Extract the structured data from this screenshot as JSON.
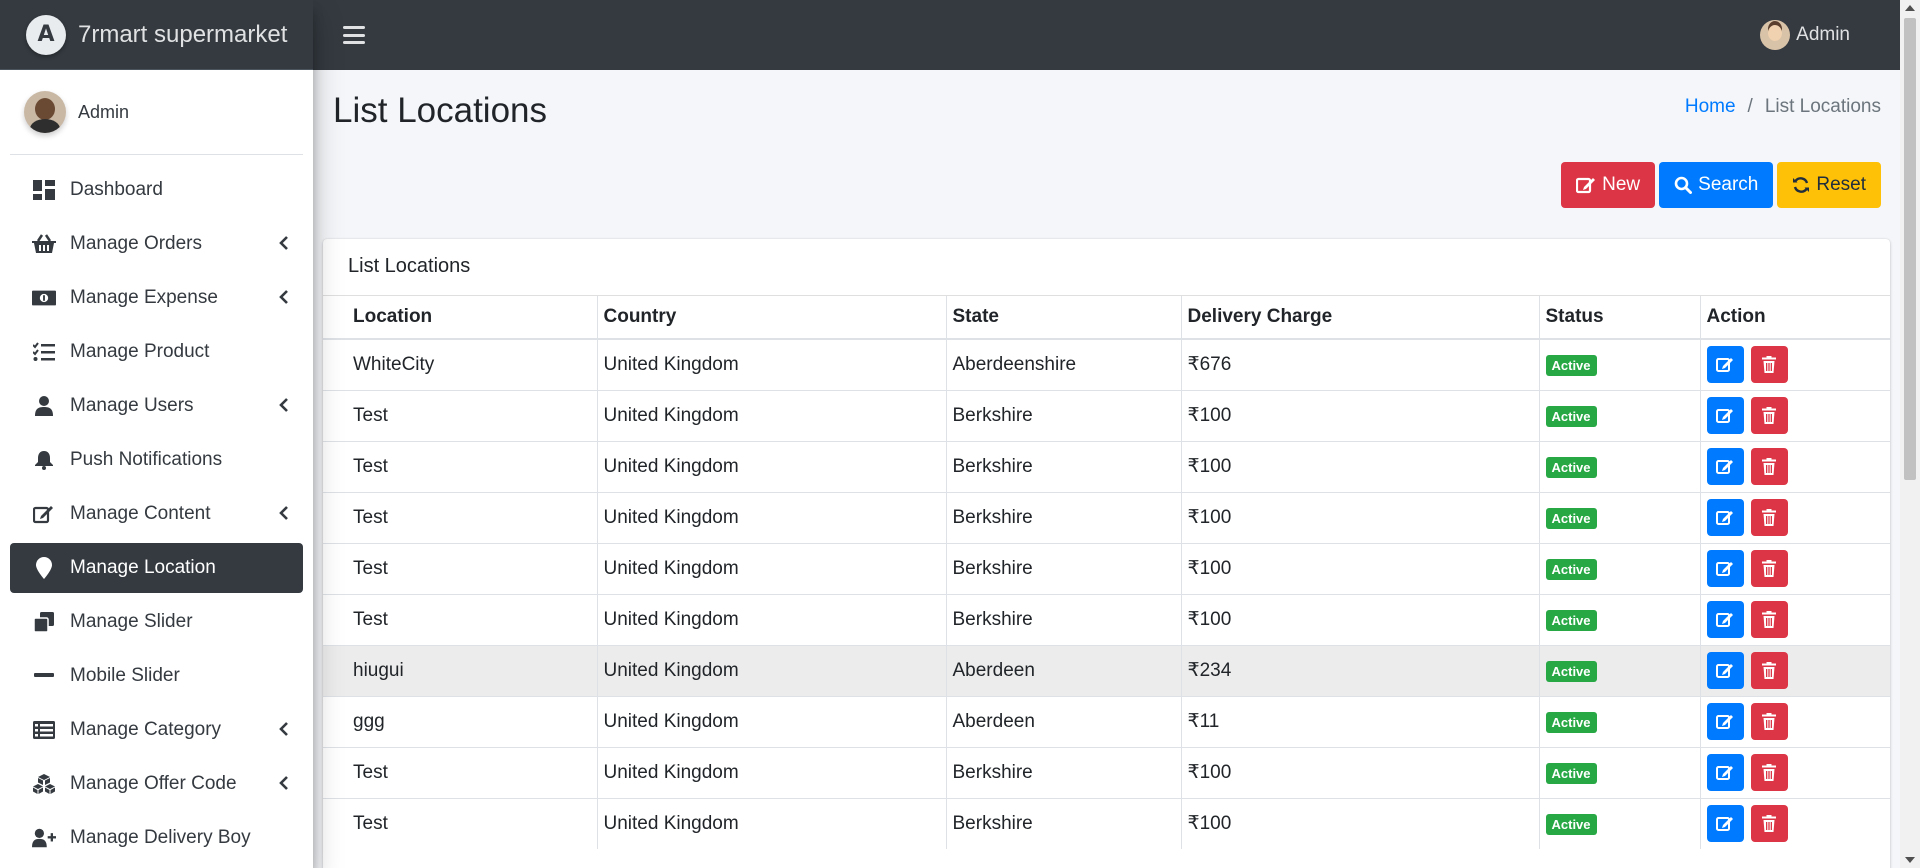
{
  "brand": {
    "logo_letter": "A",
    "name": "7rmart supermarket"
  },
  "sidebar_user": {
    "name": "Admin"
  },
  "nav": [
    {
      "label": "Dashboard",
      "icon": "dashboard-icon",
      "chevron": false,
      "active": false
    },
    {
      "label": "Manage Orders",
      "icon": "basket-icon",
      "chevron": true,
      "active": false
    },
    {
      "label": "Manage Expense",
      "icon": "money-icon",
      "chevron": true,
      "active": false
    },
    {
      "label": "Manage Product",
      "icon": "list-check-icon",
      "chevron": false,
      "active": false
    },
    {
      "label": "Manage Users",
      "icon": "user-icon",
      "chevron": true,
      "active": false
    },
    {
      "label": "Push Notifications",
      "icon": "bell-icon",
      "chevron": false,
      "active": false
    },
    {
      "label": "Manage Content",
      "icon": "edit-icon",
      "chevron": true,
      "active": false
    },
    {
      "label": "Manage Location",
      "icon": "map-marker-icon",
      "chevron": false,
      "active": true
    },
    {
      "label": "Manage Slider",
      "icon": "clone-icon",
      "chevron": false,
      "active": false
    },
    {
      "label": "Mobile Slider",
      "icon": "minus-icon",
      "chevron": false,
      "active": false
    },
    {
      "label": "Manage Category",
      "icon": "list-icon",
      "chevron": true,
      "active": false
    },
    {
      "label": "Manage Offer Code",
      "icon": "cubes-icon",
      "chevron": true,
      "active": false
    },
    {
      "label": "Manage Delivery Boy",
      "icon": "user-plus-icon",
      "chevron": false,
      "active": false
    }
  ],
  "topbar": {
    "user_name": "Admin"
  },
  "page": {
    "title": "List Locations",
    "breadcrumb": {
      "home": "Home",
      "separator": "/",
      "current": "List Locations"
    }
  },
  "buttons": {
    "new": "New",
    "search": "Search",
    "reset": "Reset"
  },
  "card": {
    "title": "List Locations"
  },
  "table": {
    "headers": [
      "Location",
      "Country",
      "State",
      "Delivery Charge",
      "Status",
      "Action"
    ],
    "rows": [
      [
        "WhiteCity",
        "United Kingdom",
        "Aberdeenshire",
        "₹676",
        "Active"
      ],
      [
        "Test",
        "United Kingdom",
        "Berkshire",
        "₹100",
        "Active"
      ],
      [
        "Test",
        "United Kingdom",
        "Berkshire",
        "₹100",
        "Active"
      ],
      [
        "Test",
        "United Kingdom",
        "Berkshire",
        "₹100",
        "Active"
      ],
      [
        "Test",
        "United Kingdom",
        "Berkshire",
        "₹100",
        "Active"
      ],
      [
        "Test",
        "United Kingdom",
        "Berkshire",
        "₹100",
        "Active"
      ],
      [
        "hiugui",
        "United Kingdom",
        "Aberdeen",
        "₹234",
        "Active"
      ],
      [
        "ggg",
        "United Kingdom",
        "Aberdeen",
        "₹11",
        "Active"
      ],
      [
        "Test",
        "United Kingdom",
        "Berkshire",
        "₹100",
        "Active"
      ],
      [
        "Test",
        "United Kingdom",
        "Berkshire",
        "₹100",
        "Active"
      ]
    ],
    "hover_row": 6
  },
  "colors": {
    "navbar": "#343a40",
    "primary": "#007bff",
    "danger": "#dc3545",
    "warning": "#ffc107",
    "success": "#28a745",
    "content_bg": "#f4f6f9"
  }
}
